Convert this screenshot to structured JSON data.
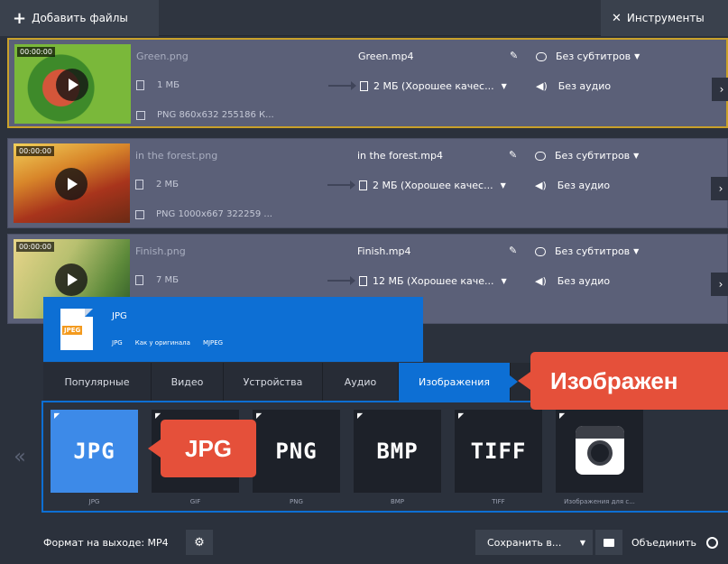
{
  "toolbar": {
    "add_files_label": "Добавить файлы",
    "tools_label": "Инструменты"
  },
  "files": [
    {
      "timecode": "00:00:00",
      "source_name": "Green.png",
      "source_size": "1 МБ",
      "source_info": "PNG 860x632 255186 К...",
      "output_name": "Green.mp4",
      "output_size": "2 МБ (Хорошее качес...",
      "subtitles": "Без субтитров",
      "audio": "Без аудио",
      "selected": true
    },
    {
      "timecode": "00:00:00",
      "source_name": "in the forest.png",
      "source_size": "2 МБ",
      "source_info": "PNG 1000x667 322259 ...",
      "output_name": "in the forest.mp4",
      "output_size": "2 МБ (Хорошее качес...",
      "subtitles": "Без субтитров",
      "audio": "Без аудио",
      "selected": false
    },
    {
      "timecode": "00:00:00",
      "source_name": "Finish.png",
      "source_size": "7 МБ",
      "source_info": "",
      "output_name": "Finish.mp4",
      "output_size": "12 МБ (Хорошее каче...",
      "subtitles": "Без субтитров",
      "audio": "Без аудио",
      "selected": false
    }
  ],
  "tooltip": {
    "doc_label": "JPEG",
    "title": "JPG",
    "meta": [
      "JPG",
      "Как у оригинала",
      "MJPEG"
    ]
  },
  "tabs": [
    {
      "label": "Популярные"
    },
    {
      "label": "Видео"
    },
    {
      "label": "Устройства"
    },
    {
      "label": "Аудио"
    },
    {
      "label": "Изображения",
      "active": true
    }
  ],
  "callouts": {
    "tab_callout": "Изображен",
    "format_callout": "JPG"
  },
  "formats": [
    {
      "logo": "JPG",
      "label": "JPG",
      "selected": true
    },
    {
      "logo": "",
      "label": "GIF",
      "selected": false
    },
    {
      "logo": "PNG",
      "label": "PNG",
      "selected": false
    },
    {
      "logo": "BMP",
      "label": "BMP",
      "selected": false
    },
    {
      "logo": "TIFF",
      "label": "TIFF",
      "selected": false
    },
    {
      "logo": "",
      "label": "Изображения для с...",
      "selected": false
    }
  ],
  "scroll_left_glyph": "«",
  "bottom": {
    "output_format": "Формат на выходе: MP4",
    "save_label": "Сохранить в...",
    "merge_label": "Объединить"
  },
  "colors": {
    "accent_blue": "#0d6fd4",
    "callout_red": "#e5503a",
    "selected_border": "#c9a12a",
    "row_bg": "#5b6078"
  }
}
